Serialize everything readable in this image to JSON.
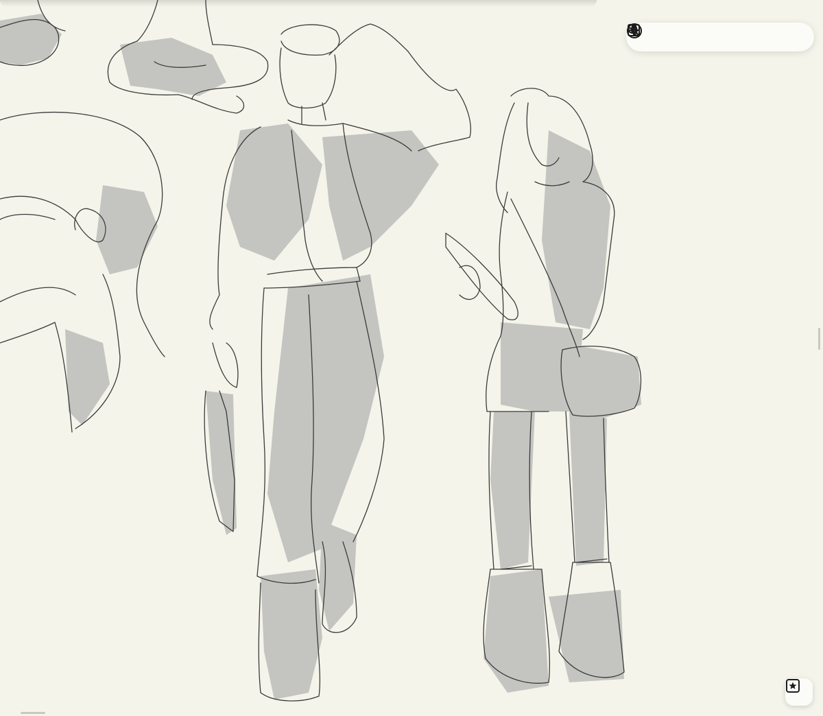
{
  "app": {
    "canvas_background": "#f4f4ea",
    "sketch_line_color": "#3a3a3a",
    "sketch_shadow_color": "#c4c5c0"
  },
  "toolbar": {
    "items": [
      {
        "id": "back",
        "icon": "chevron-left-icon",
        "enabled": true
      },
      {
        "id": "pin",
        "icon": "pin-icon",
        "enabled": true
      },
      {
        "id": "undo",
        "icon": "undo-icon",
        "enabled": true
      },
      {
        "id": "redo",
        "icon": "redo-icon",
        "enabled": false
      },
      {
        "id": "frame",
        "icon": "frame-icon",
        "enabled": true
      },
      {
        "id": "search",
        "icon": "search-icon",
        "enabled": true
      },
      {
        "id": "add",
        "icon": "plus-icon",
        "enabled": true
      }
    ]
  },
  "floating_button": {
    "icon": "star-square-icon"
  },
  "artwork": {
    "elements": [
      "seated-figure-sketch",
      "head-closeup-sketch",
      "male-character-sketch",
      "female-character-sketch"
    ]
  }
}
